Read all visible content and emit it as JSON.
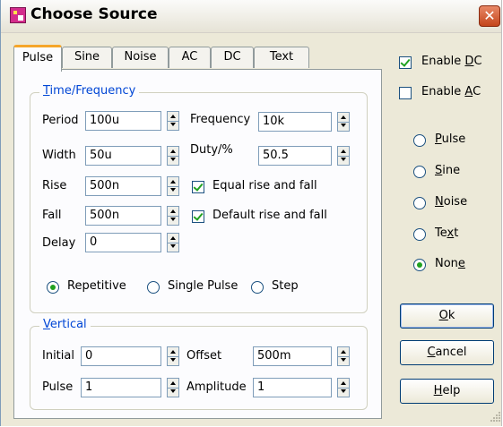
{
  "window": {
    "title": "Choose Source"
  },
  "tabs": [
    "Pulse",
    "Sine",
    "Noise",
    "AC",
    "DC",
    "Text"
  ],
  "time_group": {
    "title_pre": "",
    "title_key": "T",
    "title_post": "ime/Frequency",
    "period_label": "Period",
    "period_value": "100u",
    "width_label": "Width",
    "width_value": "50u",
    "rise_label": "Rise",
    "rise_value": "500n",
    "fall_label": "Fall",
    "fall_value": "500n",
    "delay_label": "Delay",
    "delay_value": "0",
    "frequency_label": "Frequency",
    "frequency_value": "10k",
    "duty_label": "Duty/%",
    "duty_value": "50.5",
    "equal_rise_fall_label": "Equal rise and fall",
    "default_rise_fall_label": "Default rise and fall",
    "repetitive_label": "Repetitive",
    "single_pulse_label": "Single Pulse",
    "step_label": "Step"
  },
  "vertical_group": {
    "title_key": "V",
    "title_post": "ertical",
    "initial_label": "Initial",
    "initial_value": "0",
    "pulse_label": "Pulse",
    "pulse_value": "1",
    "offset_label": "Offset",
    "offset_value": "500m",
    "amplitude_label": "Amplitude",
    "amplitude_value": "1"
  },
  "right_panel": {
    "enable_dc": {
      "pre": "Enable ",
      "key": "D",
      "post": "C",
      "checked": true
    },
    "enable_ac": {
      "pre": "Enable ",
      "key": "A",
      "post": "C",
      "checked": false
    },
    "radios": [
      {
        "pre": "",
        "key": "P",
        "post": "ulse",
        "selected": false
      },
      {
        "pre": "",
        "key": "S",
        "post": "ine",
        "selected": false
      },
      {
        "pre": "",
        "key": "N",
        "post": "oise",
        "selected": false
      },
      {
        "pre": "Te",
        "key": "x",
        "post": "t",
        "selected": false
      },
      {
        "pre": "Non",
        "key": "e",
        "post": "",
        "selected": true
      }
    ]
  },
  "buttons": {
    "ok": {
      "key": "O",
      "post": "k"
    },
    "cancel": {
      "key": "C",
      "post": "ancel"
    },
    "help": {
      "key": "H",
      "post": "elp"
    }
  },
  "icons": {
    "close": "close-icon",
    "app": "app-icon",
    "grip": "resize-grip-icon"
  },
  "colors": {
    "accent_tab": "#f5a62a",
    "group_title": "#0046d5",
    "check": "#21a121",
    "close": "#c4451c"
  }
}
